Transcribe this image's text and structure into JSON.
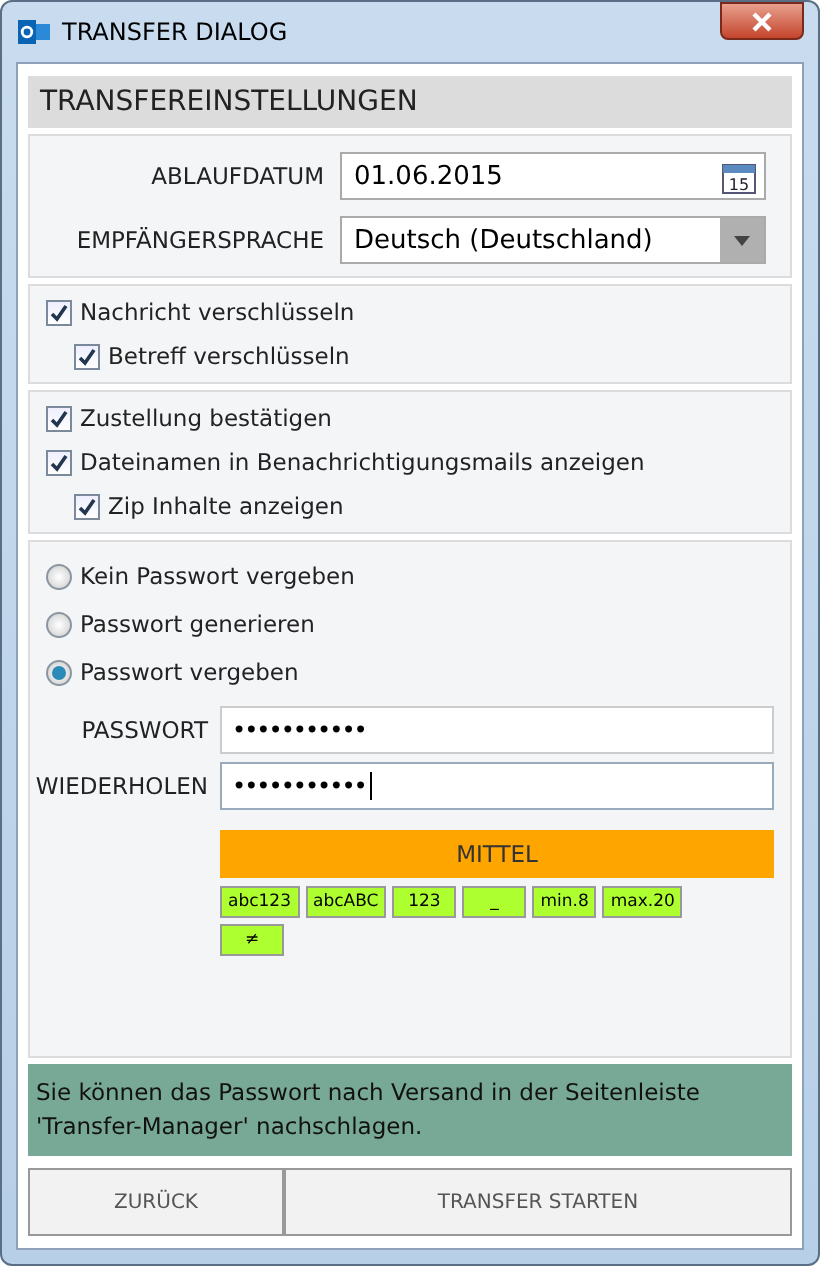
{
  "window": {
    "title": "TRANSFER DIALOG"
  },
  "header": "TRANSFEREINSTELLUNGEN",
  "fields": [
    {
      "kind": "date",
      "label": "ABLAUFDATUM",
      "value": "01.06.2015",
      "calendar_day": "15"
    },
    {
      "kind": "select",
      "label": "EMPFÄNGERSPRACHE",
      "value": "Deutsch (Deutschland)"
    }
  ],
  "encryption_options": [
    {
      "label": "Nachricht verschlüsseln",
      "checked": true,
      "children": [
        {
          "label": "Betreff verschlüsseln",
          "checked": true
        }
      ]
    }
  ],
  "notification_options": [
    {
      "label": "Zustellung bestätigen",
      "checked": true
    },
    {
      "label": "Dateinamen in Benachrichtigungsmails anzeigen",
      "checked": true,
      "children": [
        {
          "label": "Zip Inhalte anzeigen",
          "checked": true
        }
      ]
    }
  ],
  "password_modes": [
    {
      "label": "Kein Passwort vergeben",
      "selected": false
    },
    {
      "label": "Passwort generieren",
      "selected": false
    },
    {
      "label": "Passwort vergeben",
      "selected": true
    }
  ],
  "password_fields": [
    {
      "label": "PASSWORT",
      "value": "•••••••••••",
      "focused": false
    },
    {
      "label": "WIEDERHOLEN",
      "value": "•••••••••••",
      "focused": true
    }
  ],
  "strength": {
    "label": "MITTEL",
    "color": "#ffa500"
  },
  "rules": [
    {
      "label": "abc123",
      "met": true
    },
    {
      "label": "abcABC",
      "met": true
    },
    {
      "label": "123",
      "met": true
    },
    {
      "label": "_",
      "met": true
    },
    {
      "label": "min.8",
      "met": true
    },
    {
      "label": "max.20",
      "met": true
    },
    {
      "label": "≠",
      "met": true
    }
  ],
  "info": "Sie können das Passwort nach Versand in der Seitenleiste 'Transfer-Manager' nachschlagen.",
  "buttons": [
    {
      "label": "ZURÜCK"
    },
    {
      "label": "TRANSFER STARTEN"
    }
  ]
}
